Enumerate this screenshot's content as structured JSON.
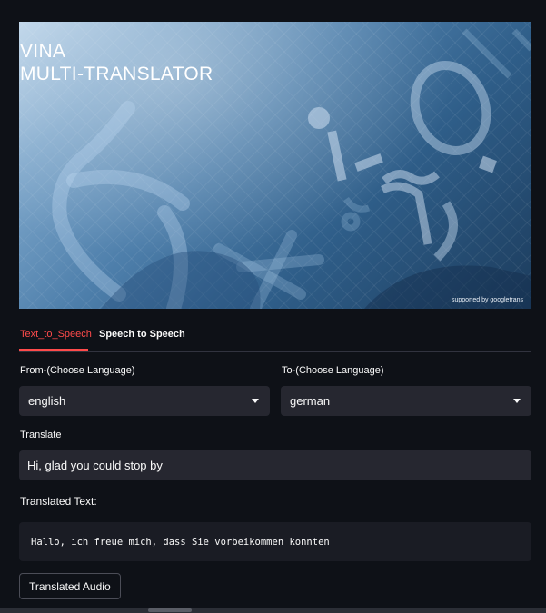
{
  "banner": {
    "title": "VINA\nMULTI-TRANSLATOR",
    "credit": "supported by googletrans"
  },
  "tabs": [
    {
      "label": "Text_to_Speech",
      "active": true
    },
    {
      "label": "Speech to Speech",
      "active": false
    }
  ],
  "from_language": {
    "label": "From-(Choose Language)",
    "value": "english"
  },
  "to_language": {
    "label": "To-(Choose Language)",
    "value": "german"
  },
  "translate": {
    "label": "Translate",
    "value": "Hi, glad you could stop by"
  },
  "translated": {
    "label": "Translated Text:",
    "value": "Hallo, ich freue mich, dass Sie vorbeikommen konnten"
  },
  "audio_button": {
    "label": "Translated Audio"
  },
  "colors": {
    "accent": "#ff4b4b",
    "background": "#0e1117",
    "input_bg": "#262730"
  }
}
